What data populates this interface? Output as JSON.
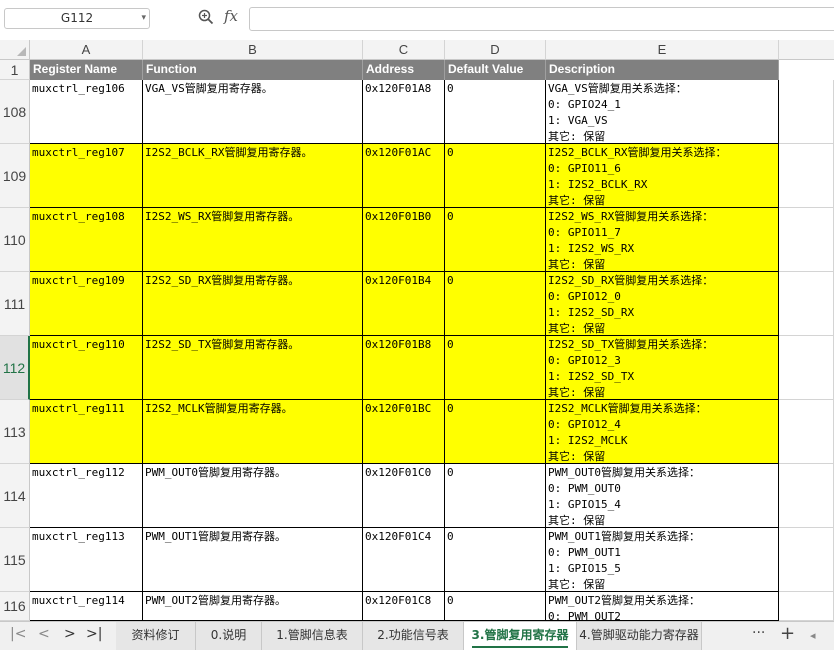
{
  "formula_bar": {
    "name_box": "G112",
    "fx_label": "fx",
    "formula": ""
  },
  "columns": [
    "A",
    "B",
    "C",
    "D",
    "E"
  ],
  "header_row": {
    "row_number": "1",
    "cells": [
      "Register Name",
      "Function",
      "Address",
      "Default Value",
      "Description"
    ]
  },
  "rows": [
    {
      "num": "108",
      "fill": "white",
      "name": "muxctrl_reg106",
      "func": "VGA_VS管脚复用寄存器。",
      "addr": "0x120F01A8",
      "def": "0",
      "desc": "VGA_VS管脚复用关系选择：\n0: GPIO24_1\n1: VGA_VS\n其它: 保留"
    },
    {
      "num": "109",
      "fill": "yellow",
      "name": "muxctrl_reg107",
      "func": "I2S2_BCLK_RX管脚复用寄存器。",
      "addr": "0x120F01AC",
      "def": "0",
      "desc": "I2S2_BCLK_RX管脚复用关系选择：\n0: GPIO11_6\n1: I2S2_BCLK_RX\n其它: 保留"
    },
    {
      "num": "110",
      "fill": "yellow",
      "name": "muxctrl_reg108",
      "func": "I2S2_WS_RX管脚复用寄存器。",
      "addr": "0x120F01B0",
      "def": "0",
      "desc": "I2S2_WS_RX管脚复用关系选择：\n0: GPIO11_7\n1: I2S2_WS_RX\n其它: 保留"
    },
    {
      "num": "111",
      "fill": "yellow",
      "name": "muxctrl_reg109",
      "func": "I2S2_SD_RX管脚复用寄存器。",
      "addr": "0x120F01B4",
      "def": "0",
      "desc": "I2S2_SD_RX管脚复用关系选择：\n0: GPIO12_0\n1: I2S2_SD_RX\n其它: 保留"
    },
    {
      "num": "112",
      "fill": "yellow",
      "name": "muxctrl_reg110",
      "func": "I2S2_SD_TX管脚复用寄存器。",
      "addr": "0x120F01B8",
      "def": "0",
      "desc": "I2S2_SD_TX管脚复用关系选择：\n0: GPIO12_3\n1: I2S2_SD_TX\n其它: 保留"
    },
    {
      "num": "113",
      "fill": "yellow",
      "name": "muxctrl_reg111",
      "func": "I2S2_MCLK管脚复用寄存器。",
      "addr": "0x120F01BC",
      "def": "0",
      "desc": "I2S2_MCLK管脚复用关系选择：\n0: GPIO12_4\n1: I2S2_MCLK\n其它: 保留"
    },
    {
      "num": "114",
      "fill": "white",
      "name": "muxctrl_reg112",
      "func": "PWM_OUT0管脚复用寄存器。",
      "addr": "0x120F01C0",
      "def": "0",
      "desc": "PWM_OUT0管脚复用关系选择：\n0: PWM_OUT0\n1: GPIO15_4\n其它: 保留"
    },
    {
      "num": "115",
      "fill": "white",
      "name": "muxctrl_reg113",
      "func": "PWM_OUT1管脚复用寄存器。",
      "addr": "0x120F01C4",
      "def": "0",
      "desc": "PWM_OUT1管脚复用关系选择：\n0: PWM_OUT1\n1: GPIO15_5\n其它: 保留"
    },
    {
      "num": "116",
      "fill": "white",
      "name": "muxctrl_reg114",
      "func": "PWM_OUT2管脚复用寄存器。",
      "addr": "0x120F01C8",
      "def": "0",
      "desc": "PWM_OUT2管脚复用关系选择：\n0: PWM_OUT2"
    }
  ],
  "selected_row": "112",
  "tabs": [
    "资料修订",
    "0.说明",
    "1.管脚信息表",
    "2.功能信号表",
    "3.管脚复用寄存器",
    "4.管脚驱动能力寄存器"
  ],
  "active_tab": "3.管脚复用寄存器",
  "tab_nav": {
    "first": "|<",
    "prev": "<",
    "next": ">",
    "last": ">|",
    "more": "···",
    "add": "+"
  },
  "colors": {
    "highlight": "#ffff00",
    "header_fill": "#808080",
    "active_tab": "#217346"
  }
}
